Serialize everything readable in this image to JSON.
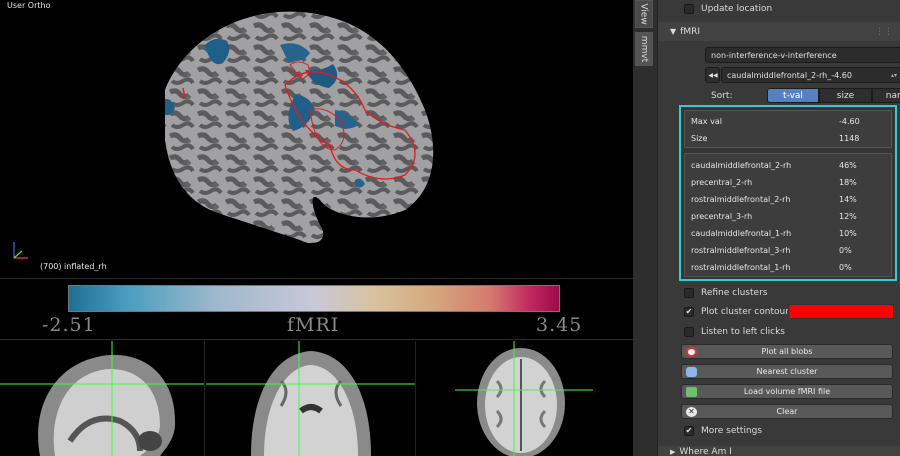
{
  "viewport": {
    "view_title": "User Ortho",
    "surface_label": "(700) inflated_rh",
    "colorbar": {
      "min_label": "-2.51",
      "center_label": "fMRI",
      "max_label": "3.45"
    }
  },
  "tabs": [
    "View",
    "mmvt"
  ],
  "panel": {
    "update_location": {
      "label": "Update location",
      "checked": false
    },
    "section_fmri": {
      "label": "fMRI",
      "arrow": "▼"
    },
    "contrast_dropdown": {
      "value": "non-interference-v-interference"
    },
    "cluster_dropdown": {
      "value": "caudalmiddlefrontal_2-rh_-4.60",
      "prev_icon": "◀◀",
      "next_icon": "▶▶"
    },
    "sort": {
      "label": "Sort:",
      "options": [
        "t-val",
        "size",
        "name"
      ],
      "selected": "t-val"
    },
    "cluster_info": {
      "max_val_label": "Max val",
      "max_val": "-4.60",
      "size_label": "Size",
      "size": "1148",
      "regions": [
        {
          "name": "caudalmiddlefrontal_2-rh",
          "pct": "46%"
        },
        {
          "name": "precentral_2-rh",
          "pct": "18%"
        },
        {
          "name": "rostralmiddlefrontal_2-rh",
          "pct": "14%"
        },
        {
          "name": "precentral_3-rh",
          "pct": "12%"
        },
        {
          "name": "caudalmiddlefrontal_1-rh",
          "pct": "10%"
        },
        {
          "name": "rostralmiddlefrontal_3-rh",
          "pct": "0%"
        },
        {
          "name": "rostralmiddlefrontal_1-rh",
          "pct": "0%"
        }
      ]
    },
    "refine_clusters": {
      "label": "Refine clusters",
      "checked": false
    },
    "plot_cluster_contours": {
      "label": "Plot cluster contours",
      "checked": true,
      "color": "#ff0000"
    },
    "listen_left_clicks": {
      "label": "Listen to left clicks",
      "checked": false
    },
    "buttons": {
      "plot_all_blobs": "Plot all blobs",
      "nearest_cluster": "Nearest cluster",
      "load_volume": "Load volume fMRI file",
      "clear": "Clear"
    },
    "more_settings": {
      "label": "More settings",
      "checked": true
    },
    "where_am_i": {
      "label": "Where Am I",
      "arrow": "▶"
    }
  },
  "colors": {
    "accent_blue": "#5680c2",
    "highlight_cyan": "#3fc6d6",
    "cursor_green": "#3cff3c"
  }
}
